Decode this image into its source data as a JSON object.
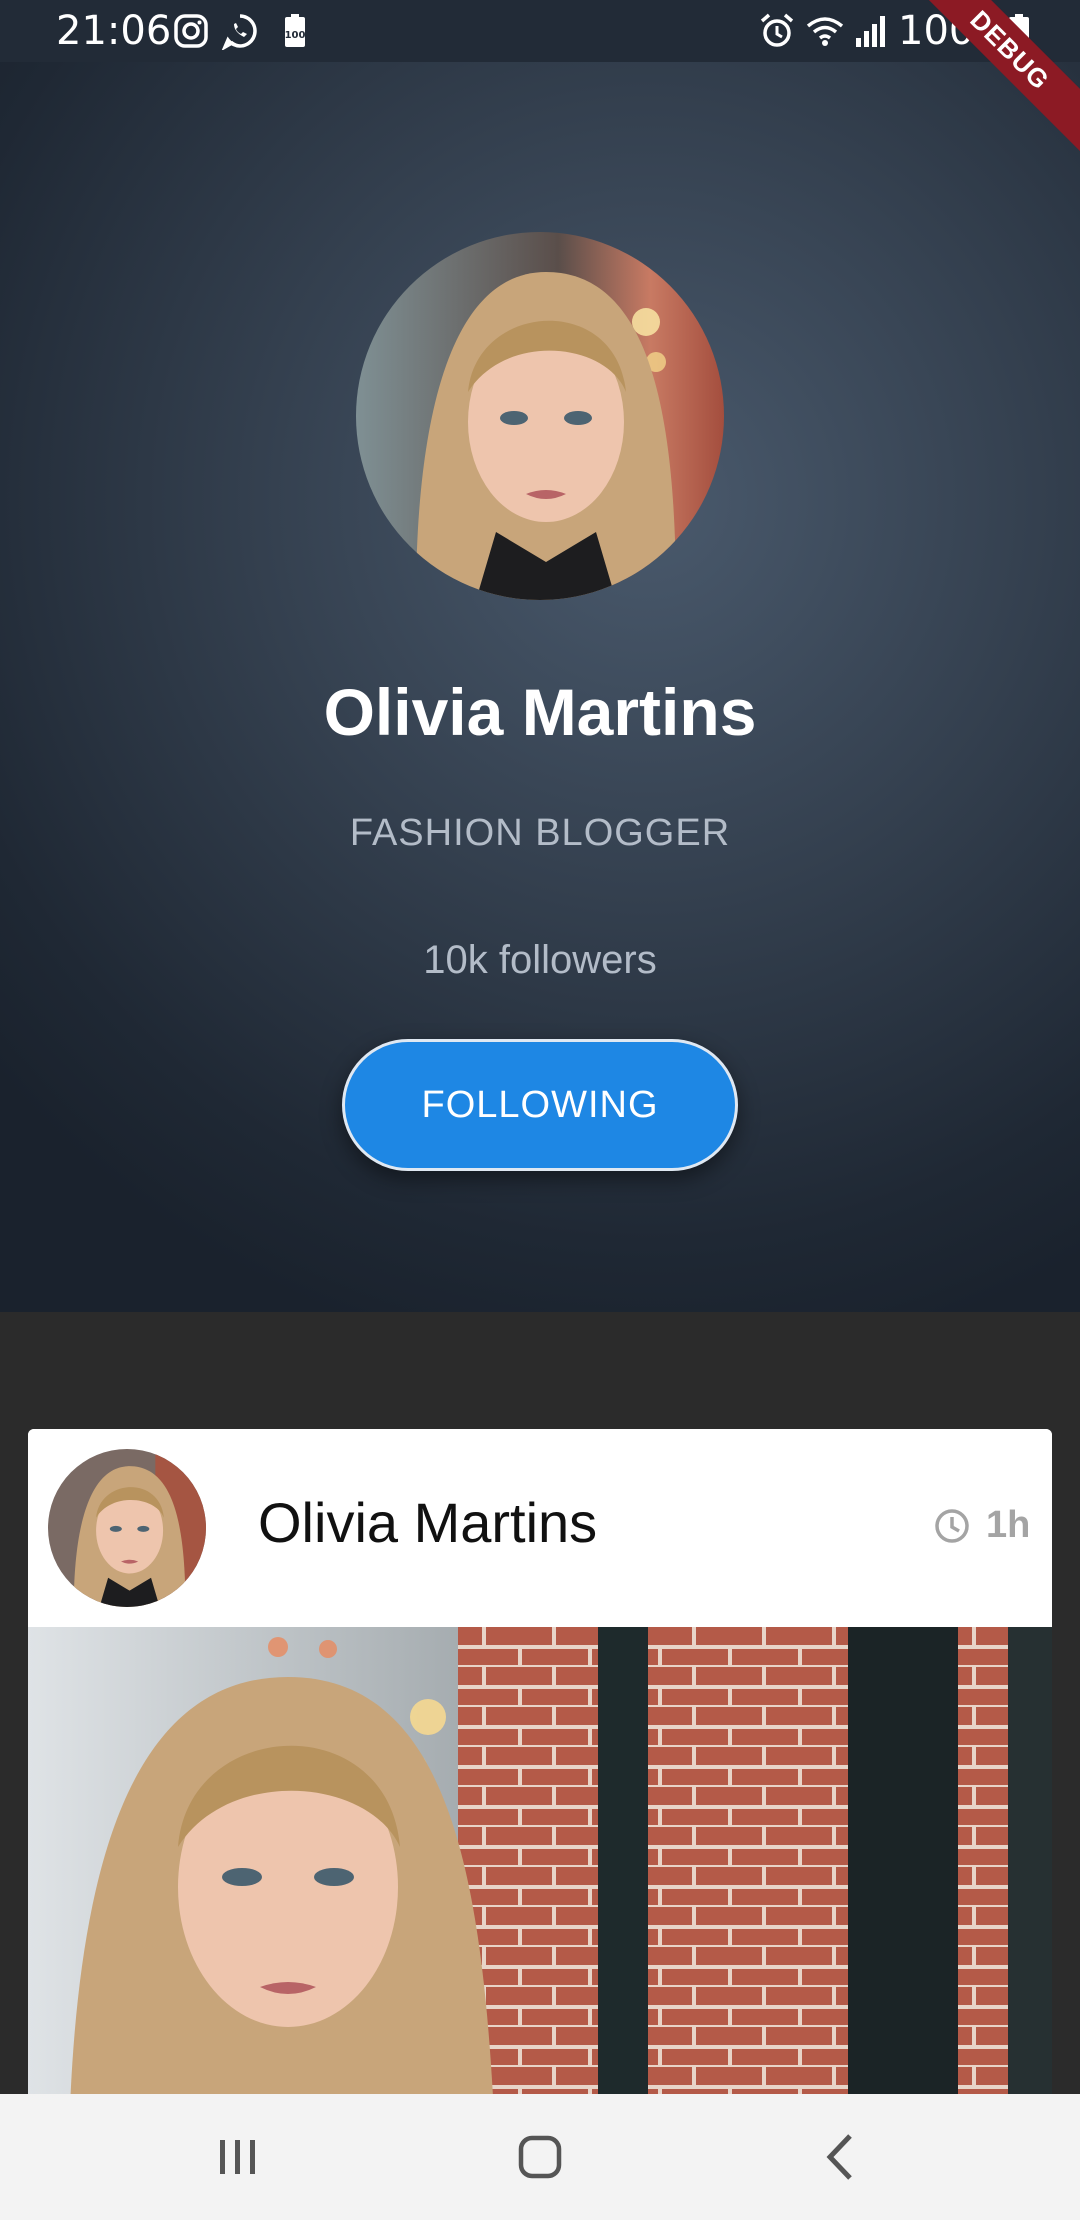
{
  "status_bar": {
    "time": "21:06",
    "battery_percent": "100%",
    "left_icons": [
      "instagram-icon",
      "whatsapp-icon",
      "battery-saver-icon"
    ],
    "right_icons": [
      "alarm-icon",
      "wifi-icon",
      "signal-icon",
      "battery-icon"
    ]
  },
  "debug_banner": "DEBUG",
  "profile": {
    "name": "Olivia Martins",
    "title": "FASHION BLOGGER",
    "followers": "10k followers",
    "follow_button_label": "FOLLOWING",
    "accent_color": "#1e87e4"
  },
  "post": {
    "author": "Olivia Martins",
    "time": "1h"
  },
  "nav_bar": {
    "buttons": [
      "recent-apps",
      "home",
      "back"
    ]
  }
}
